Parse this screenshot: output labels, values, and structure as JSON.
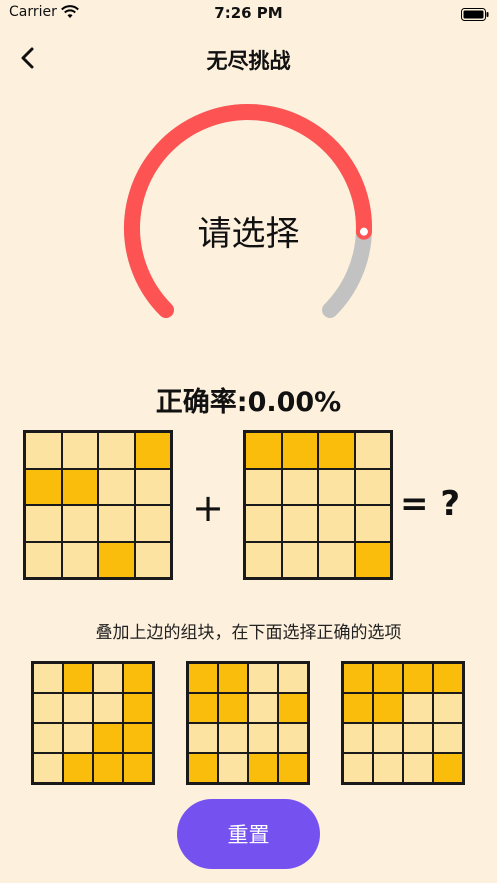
{
  "status_bar": {
    "carrier": "Carrier",
    "time": "7:26 PM"
  },
  "nav": {
    "title": "无尽挑战",
    "back_icon": "chevron-left-icon"
  },
  "gauge": {
    "label": "请选择",
    "progress": 0.84,
    "color_active": "#fd5352",
    "color_rest": "#c2c2c2"
  },
  "accuracy": "正确率:0.00%",
  "puzzle": {
    "left": [
      [
        0,
        0,
        0,
        1
      ],
      [
        1,
        1,
        0,
        0
      ],
      [
        0,
        0,
        0,
        0
      ],
      [
        0,
        0,
        1,
        0
      ]
    ],
    "right": [
      [
        1,
        1,
        1,
        0
      ],
      [
        0,
        0,
        0,
        0
      ],
      [
        0,
        0,
        0,
        0
      ],
      [
        0,
        0,
        0,
        1
      ]
    ],
    "plus": "+",
    "equals": "= ?"
  },
  "instruction": "叠加上边的组块，在下面选择正确的选项",
  "options": [
    [
      [
        0,
        1,
        0,
        1
      ],
      [
        0,
        0,
        0,
        1
      ],
      [
        0,
        0,
        1,
        1
      ],
      [
        0,
        1,
        1,
        1
      ]
    ],
    [
      [
        1,
        1,
        0,
        0
      ],
      [
        1,
        1,
        0,
        1
      ],
      [
        0,
        0,
        0,
        0
      ],
      [
        1,
        0,
        1,
        1
      ]
    ],
    [
      [
        1,
        1,
        1,
        1
      ],
      [
        1,
        1,
        0,
        0
      ],
      [
        0,
        0,
        0,
        0
      ],
      [
        0,
        0,
        0,
        1
      ]
    ]
  ],
  "colors": {
    "background": "#fdf0dc",
    "cell_off": "#fde3a2",
    "cell_on": "#fbbd0c",
    "button": "#7552f0"
  },
  "reset_label": "重置"
}
